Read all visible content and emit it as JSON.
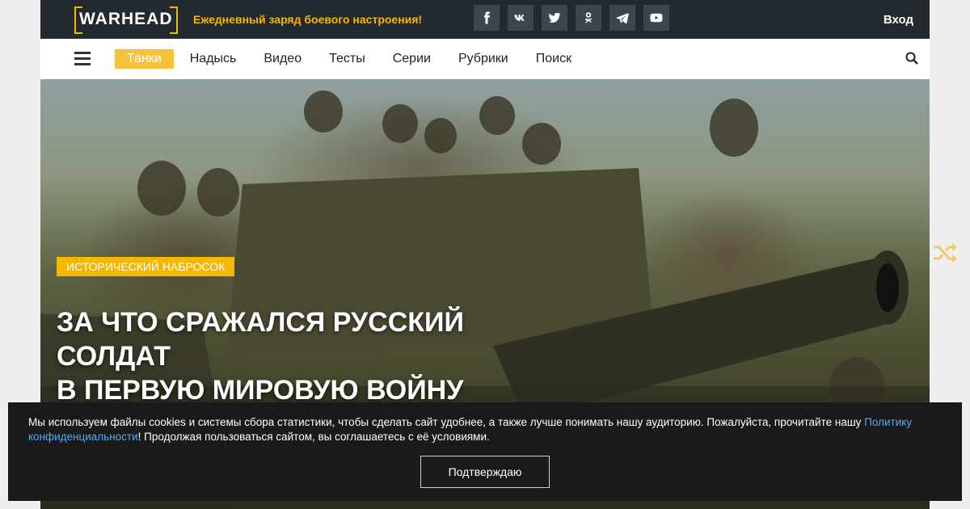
{
  "header": {
    "logo_text": "WARHEAD",
    "tagline": "Ежедневный заряд боевого настроения!",
    "login_label": "Вход",
    "socials": [
      {
        "icon": "facebook-icon"
      },
      {
        "icon": "vk-icon"
      },
      {
        "icon": "twitter-icon"
      },
      {
        "icon": "odnoklassniki-icon"
      },
      {
        "icon": "telegram-icon"
      },
      {
        "icon": "youtube-icon"
      }
    ]
  },
  "nav": {
    "items": [
      {
        "label": "Танки",
        "active": true
      },
      {
        "label": "Надысь"
      },
      {
        "label": "Видео"
      },
      {
        "label": "Тесты"
      },
      {
        "label": "Серии"
      },
      {
        "label": "Рубрики"
      },
      {
        "label": "Поиск"
      }
    ]
  },
  "hero": {
    "category": "Исторический набросок",
    "title_line1": "За что сражался русский солдат",
    "title_line2": "в Первую мировую войну"
  },
  "cookie": {
    "text_before": "Мы используем файлы cookies и системы сбора статистики, чтобы сделать сайт удобнее, а также лучше понимать нашу аудиторию. Пожалуйста, прочитайте нашу ",
    "link": "Политику конфиденциальности",
    "text_after": "! Продолжая пользоваться сайтом, вы соглашаетесь с её условиями.",
    "button": "Подтверждаю"
  },
  "colors": {
    "accent": "#f5b800",
    "topbar": "#222a30",
    "link": "#5aa9f0"
  }
}
